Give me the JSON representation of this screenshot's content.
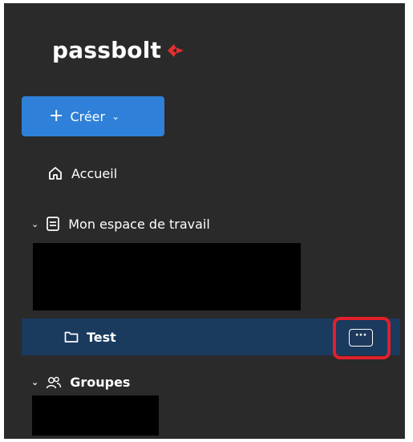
{
  "brand": {
    "name": "passbolt",
    "mark_color": "#e62e2e"
  },
  "colors": {
    "sidebar_bg": "#2a2a2a",
    "accent": "#2f80d8",
    "selected_row": "#1a3a5e",
    "highlight": "#e0202a"
  },
  "create_button": {
    "icon": "plus-icon",
    "label": "Créer",
    "caret": "chevron-down-icon"
  },
  "nav": {
    "home_label": "Accueil",
    "home_icon": "home-icon"
  },
  "workspace": {
    "label": "Mon espace de travail",
    "icon": "workspace-icon",
    "expanded": true,
    "folders": [
      {
        "label": "Test",
        "icon": "folder-icon",
        "selected": true,
        "more_label": "···"
      }
    ]
  },
  "groups": {
    "label": "Groupes",
    "icon": "users-icon",
    "expanded": true
  }
}
